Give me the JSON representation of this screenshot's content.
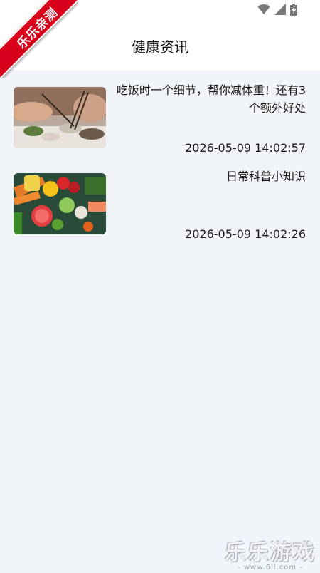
{
  "ribbon": {
    "text": "乐乐亲测"
  },
  "header": {
    "title": "健康资讯"
  },
  "news": [
    {
      "title": "吃饭时一个细节，帮你减体重！还有3个额外好处",
      "time": "2026-05-09 14:02:57",
      "image": "dining-photo"
    },
    {
      "title": "日常科普小知识",
      "time": "2026-05-09 14:02:26",
      "image": "vegetables-photo"
    }
  ],
  "watermark": {
    "main": "乐乐游戏",
    "sub": "- www.6ll.com -"
  }
}
